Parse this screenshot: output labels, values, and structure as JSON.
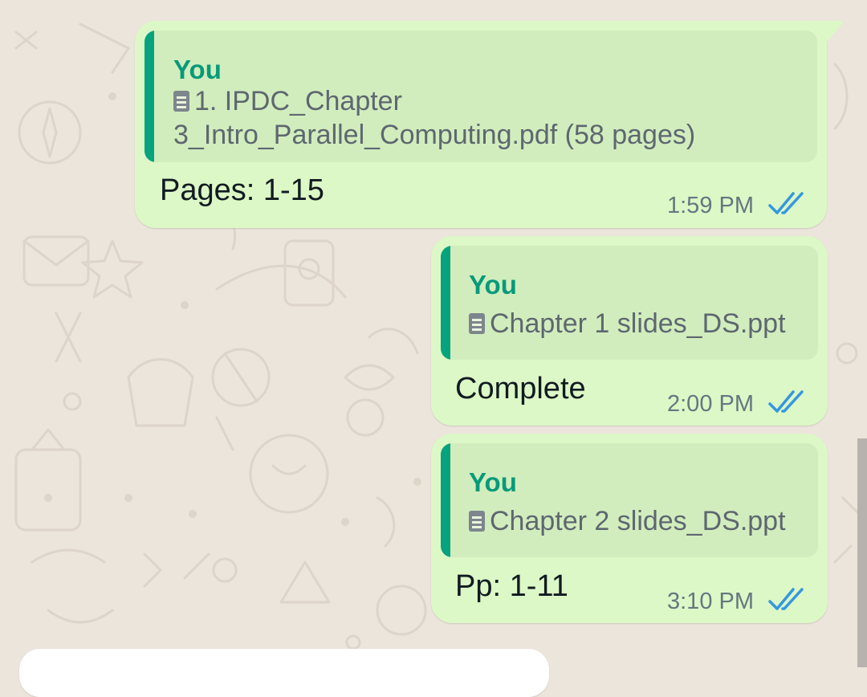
{
  "messages": [
    {
      "quote": {
        "sender": "You",
        "doc_lines": [
          "1.    IPDC_Chapter",
          "3_Intro_Parallel_Computing.pdf (58 pages)"
        ],
        "icon": "document-icon"
      },
      "text": "Pages: 1-15",
      "time": "1:59 PM",
      "status": "read",
      "status_icon": "double-check-icon"
    },
    {
      "quote": {
        "sender": "You",
        "doc_lines": [
          "Chapter 1 slides_DS.ppt"
        ],
        "icon": "document-icon"
      },
      "text": "Complete",
      "time": "2:00 PM",
      "status": "read",
      "status_icon": "double-check-icon"
    },
    {
      "quote": {
        "sender": "You",
        "doc_lines": [
          "Chapter 2 slides_DS.ppt"
        ],
        "icon": "document-icon"
      },
      "text": "Pp: 1-11",
      "time": "3:10 PM",
      "status": "read",
      "status_icon": "double-check-icon"
    }
  ],
  "colors": {
    "background": "#ece5dc",
    "outgoing_bubble": "#dcf8c6",
    "quote_accent": "#06a37e",
    "sender_name": "#079a7a",
    "read_ticks": "#3497e0"
  }
}
